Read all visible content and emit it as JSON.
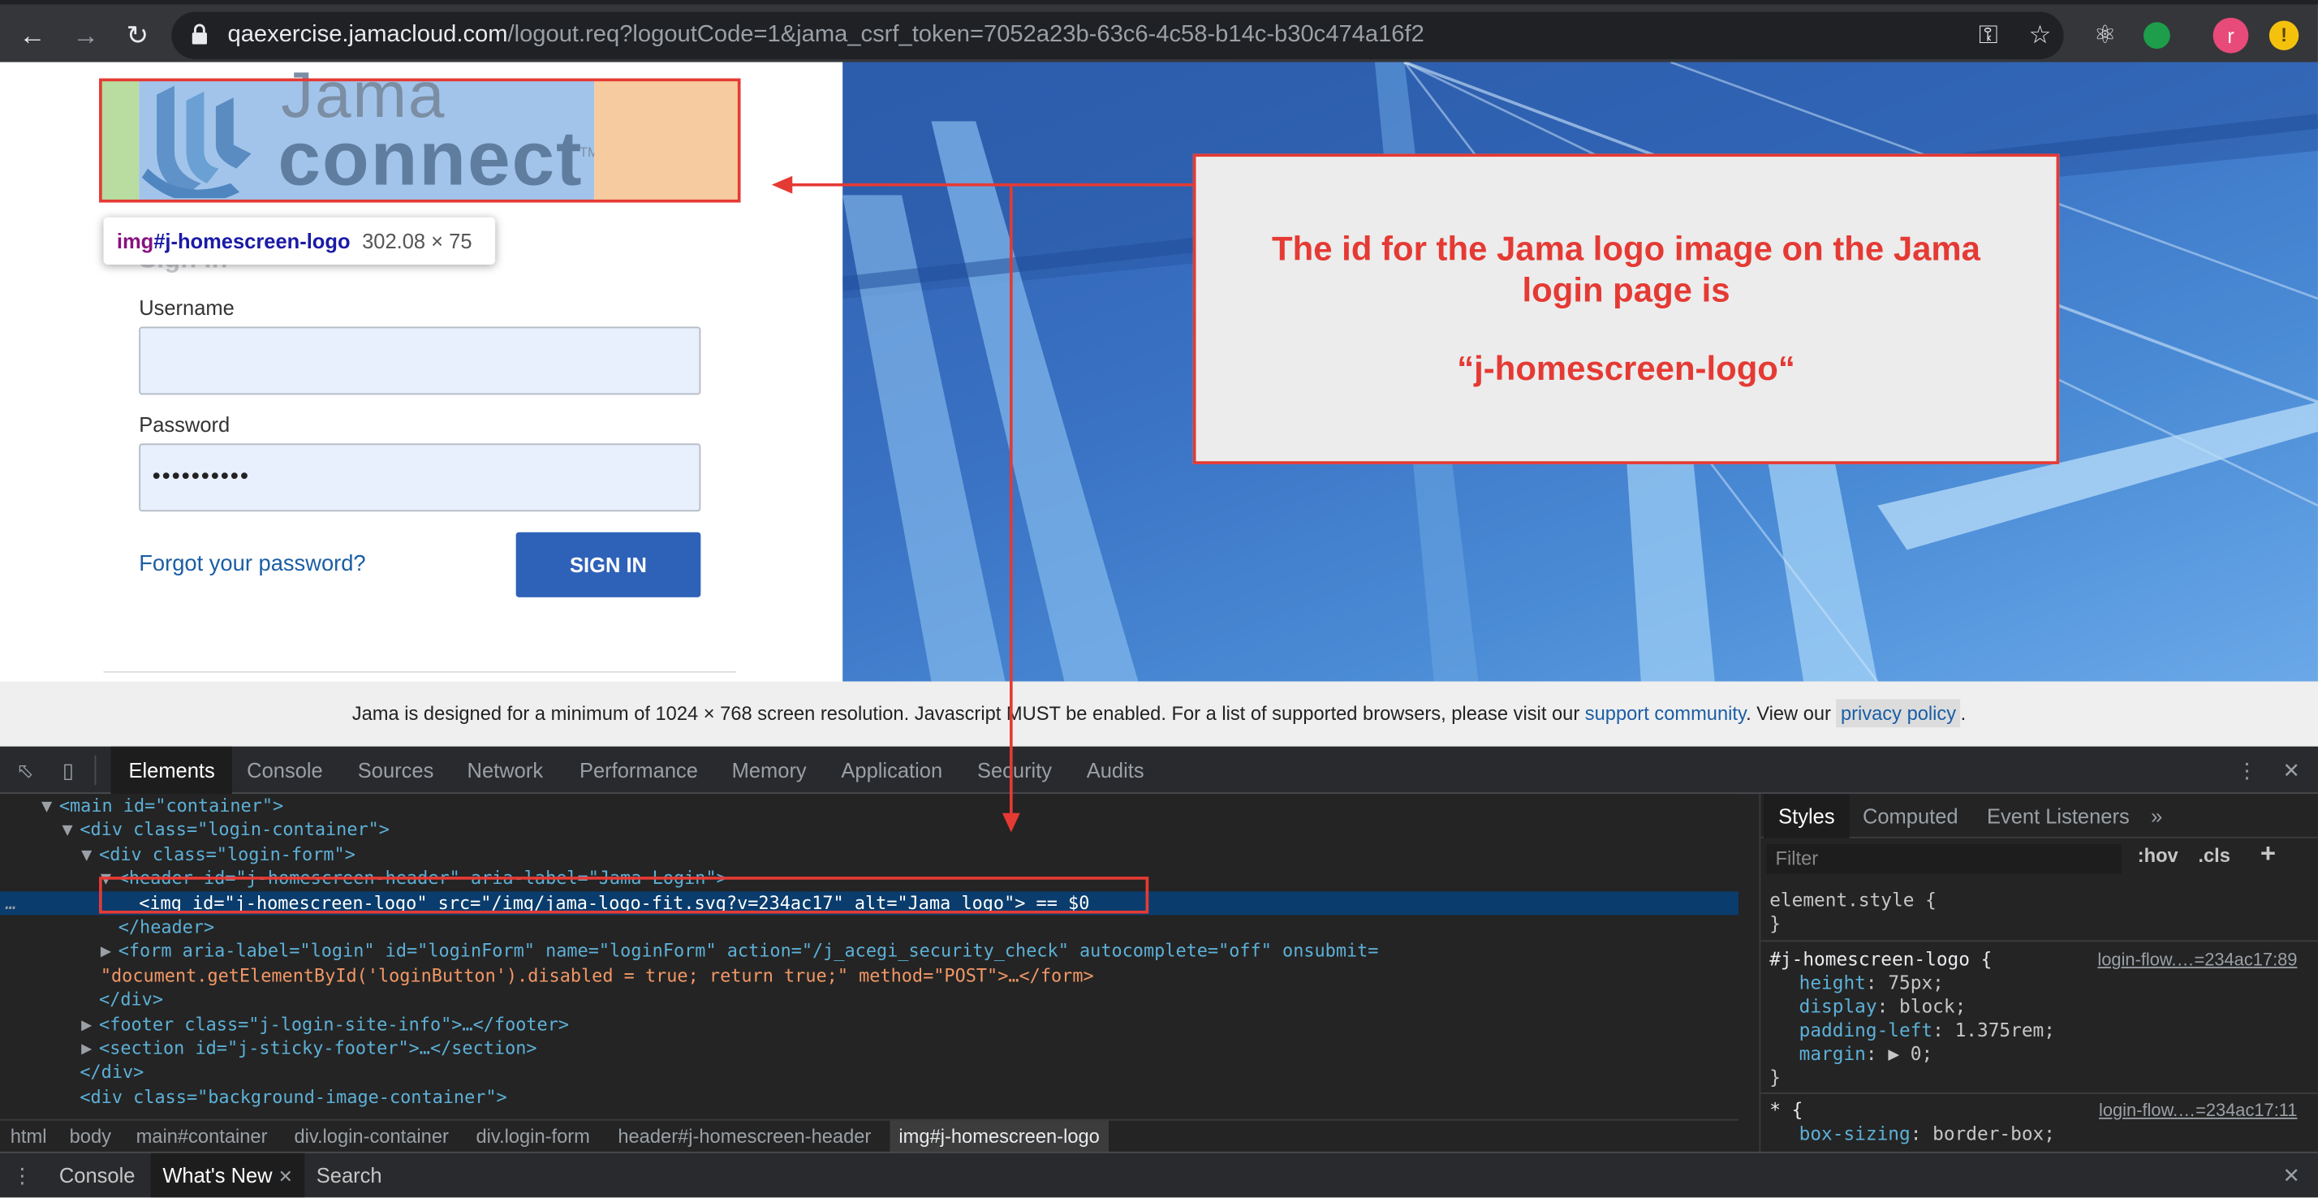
{
  "browser": {
    "url_host": "qaexercise.jamacloud.com",
    "url_path": "/logout.req?logoutCode=1&jama_csrf_token=7052a23b-63c6-4c58-b14c-b30c474a16f2",
    "avatar_letter": "r",
    "warning_glyph": "!"
  },
  "logo": {
    "word_top": "Jama",
    "word_bottom": "connect",
    "tm": "TM"
  },
  "inspect_tooltip": {
    "tag": "img",
    "id": "#j-homescreen-logo",
    "size": "302.08 × 75"
  },
  "login": {
    "sign_in_heading": "Sign In",
    "username_label": "Username",
    "username_value": "",
    "password_label": "Password",
    "password_value": "••••••••••",
    "forgot_link": "Forgot your password?",
    "sign_in_button": "SIGN IN"
  },
  "footer": {
    "text_before": "Jama is designed for a minimum of 1024 × 768 screen resolution. Javascript MUST be enabled. For a list of supported browsers, please visit our ",
    "support_link": "support community",
    "text_middle": ". View our ",
    "privacy_link": "privacy policy",
    "text_after": "."
  },
  "callout": {
    "line1": "The id for the Jama logo image on the Jama",
    "line2": "login page is",
    "id_text": "“j-homescreen-logo“",
    "color": "#e53a34"
  },
  "devtools": {
    "tabs": [
      "Elements",
      "Console",
      "Sources",
      "Network",
      "Performance",
      "Memory",
      "Application",
      "Security",
      "Audits"
    ],
    "active_tab": "Elements",
    "dom_lines": [
      {
        "tri": "▼",
        "html": "<main id=\"container\">"
      },
      {
        "tri": "▼",
        "html": "<div class=\"login-container\">"
      },
      {
        "tri": "▼",
        "html": "<div class=\"login-form\">"
      },
      {
        "tri": "▼",
        "html": "<header id=\"j-homescreen-header\" aria-label=\"Jama Login\">"
      },
      {
        "tri": "",
        "html": "<img id=\"j-homescreen-logo\" src=\"/img/jama-logo-fit.svg?v=234ac17\" alt=\"Jama logo\"> == $0"
      },
      {
        "tri": "",
        "html": "</header>"
      },
      {
        "tri": "▶",
        "html": "<form aria-label=\"login\" id=\"loginForm\" name=\"loginForm\" action=\"/j_acegi_security_check\" autocomplete=\"off\" onsubmit="
      },
      {
        "tri": "",
        "html": "\"document.getElementById('loginButton').disabled = true; return true;\" method=\"POST\">…</form>"
      },
      {
        "tri": "",
        "html": "</div>"
      },
      {
        "tri": "▶",
        "html": "<footer class=\"j-login-site-info\">…</footer>"
      },
      {
        "tri": "▶",
        "html": "<section id=\"j-sticky-footer\">…</section>"
      },
      {
        "tri": "",
        "html": "</div>"
      },
      {
        "tri": "",
        "html": "<div class=\"background-image-container\">"
      }
    ],
    "breadcrumbs": [
      "html",
      "body",
      "main#container",
      "div.login-container",
      "div.login-form",
      "header#j-homescreen-header",
      "img#j-homescreen-logo"
    ],
    "styles": {
      "tabs": [
        "Styles",
        "Computed",
        "Event Listeners"
      ],
      "active_tab": "Styles",
      "filter_placeholder": "Filter",
      "hov": ":hov",
      "cls": ".cls",
      "plus": "+",
      "element_style": "element.style {",
      "close_brace": "}",
      "rule1_selector": "#j-homescreen-logo {",
      "rule1_source": "login-flow.…=234ac17:89",
      "rule1_props": [
        {
          "name": "height",
          "value": "75px;"
        },
        {
          "name": "display",
          "value": "block;"
        },
        {
          "name": "padding-left",
          "value": "1.375rem;"
        },
        {
          "name": "margin",
          "value": "▶ 0;"
        }
      ],
      "rule2_selector": "* {",
      "rule2_source": "login-flow.…=234ac17:11",
      "rule2_prop": {
        "name": "box-sizing",
        "value": "border-box;"
      }
    },
    "drawer_tabs": [
      "Console",
      "What's New",
      "Search"
    ],
    "drawer_active": "What's New"
  }
}
